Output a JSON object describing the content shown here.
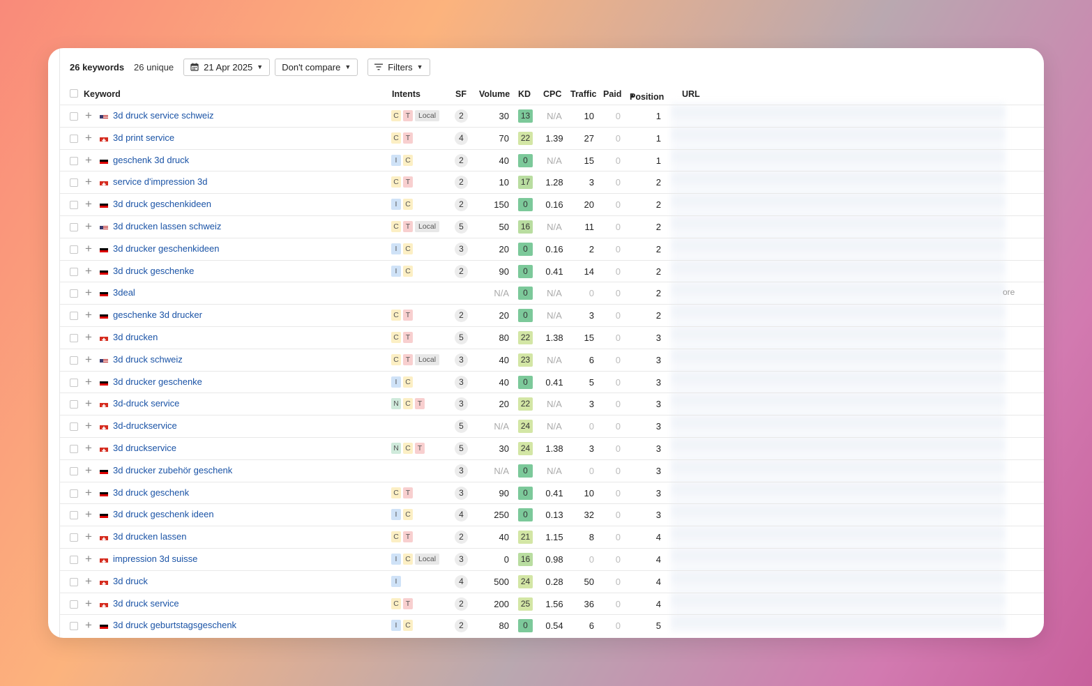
{
  "toolbar": {
    "keywords_count": "26 keywords",
    "unique_count": "26 unique",
    "date_label": "21 Apr 2025",
    "compare_label": "Don't compare",
    "filters_label": "Filters"
  },
  "columns": {
    "keyword": "Keyword",
    "intents": "Intents",
    "sf": "SF",
    "volume": "Volume",
    "kd": "KD",
    "cpc": "CPC",
    "traffic": "Traffic",
    "paid": "Paid",
    "position": "Position",
    "url": "URL"
  },
  "url_overflow_text": "ore",
  "colors": {
    "link": "#1a53a6",
    "kd_low": "#7cc99a",
    "kd_mid": "#b9dda0",
    "kd_high": "#d3e6a5"
  },
  "rows": [
    {
      "flag": "us",
      "keyword": "3d druck service schweiz",
      "intents": [
        "C",
        "T",
        "Local"
      ],
      "sf": "2",
      "volume": "30",
      "kd": "13",
      "cpc": "N/A",
      "traffic": "10",
      "paid": "0",
      "position": "1"
    },
    {
      "flag": "ch",
      "keyword": "3d print service",
      "intents": [
        "C",
        "T"
      ],
      "sf": "4",
      "volume": "70",
      "kd": "22",
      "cpc": "1.39",
      "traffic": "27",
      "paid": "0",
      "position": "1"
    },
    {
      "flag": "de",
      "keyword": "geschenk 3d druck",
      "intents": [
        "I",
        "C"
      ],
      "sf": "2",
      "volume": "40",
      "kd": "0",
      "cpc": "N/A",
      "traffic": "15",
      "paid": "0",
      "position": "1"
    },
    {
      "flag": "ch",
      "keyword": "service d'impression 3d",
      "intents": [
        "C",
        "T"
      ],
      "sf": "2",
      "volume": "10",
      "kd": "17",
      "cpc": "1.28",
      "traffic": "3",
      "paid": "0",
      "position": "2"
    },
    {
      "flag": "de",
      "keyword": "3d druck geschenkideen",
      "intents": [
        "I",
        "C"
      ],
      "sf": "2",
      "volume": "150",
      "kd": "0",
      "cpc": "0.16",
      "traffic": "20",
      "paid": "0",
      "position": "2"
    },
    {
      "flag": "us",
      "keyword": "3d drucken lassen schweiz",
      "intents": [
        "C",
        "T",
        "Local"
      ],
      "sf": "5",
      "volume": "50",
      "kd": "16",
      "cpc": "N/A",
      "traffic": "11",
      "paid": "0",
      "position": "2"
    },
    {
      "flag": "de",
      "keyword": "3d drucker geschenkideen",
      "intents": [
        "I",
        "C"
      ],
      "sf": "3",
      "volume": "20",
      "kd": "0",
      "cpc": "0.16",
      "traffic": "2",
      "paid": "0",
      "position": "2"
    },
    {
      "flag": "de",
      "keyword": "3d druck geschenke",
      "intents": [
        "I",
        "C"
      ],
      "sf": "2",
      "volume": "90",
      "kd": "0",
      "cpc": "0.41",
      "traffic": "14",
      "paid": "0",
      "position": "2"
    },
    {
      "flag": "de",
      "keyword": "3deal",
      "intents": [],
      "sf": "",
      "volume": "N/A",
      "kd": "0",
      "cpc": "N/A",
      "traffic": "0",
      "paid": "0",
      "position": "2"
    },
    {
      "flag": "de",
      "keyword": "geschenke 3d drucker",
      "intents": [
        "C",
        "T"
      ],
      "sf": "2",
      "volume": "20",
      "kd": "0",
      "cpc": "N/A",
      "traffic": "3",
      "paid": "0",
      "position": "2"
    },
    {
      "flag": "ch",
      "keyword": "3d drucken",
      "intents": [
        "C",
        "T"
      ],
      "sf": "5",
      "volume": "80",
      "kd": "22",
      "cpc": "1.38",
      "traffic": "15",
      "paid": "0",
      "position": "3"
    },
    {
      "flag": "us",
      "keyword": "3d druck schweiz",
      "intents": [
        "C",
        "T",
        "Local"
      ],
      "sf": "3",
      "volume": "40",
      "kd": "23",
      "cpc": "N/A",
      "traffic": "6",
      "paid": "0",
      "position": "3"
    },
    {
      "flag": "de",
      "keyword": "3d drucker geschenke",
      "intents": [
        "I",
        "C"
      ],
      "sf": "3",
      "volume": "40",
      "kd": "0",
      "cpc": "0.41",
      "traffic": "5",
      "paid": "0",
      "position": "3"
    },
    {
      "flag": "ch",
      "keyword": "3d-druck service",
      "intents": [
        "N",
        "C",
        "T"
      ],
      "sf": "3",
      "volume": "20",
      "kd": "22",
      "cpc": "N/A",
      "traffic": "3",
      "paid": "0",
      "position": "3"
    },
    {
      "flag": "ch",
      "keyword": "3d-druckservice",
      "intents": [],
      "sf": "5",
      "volume": "N/A",
      "kd": "24",
      "cpc": "N/A",
      "traffic": "0",
      "paid": "0",
      "position": "3"
    },
    {
      "flag": "ch",
      "keyword": "3d druckservice",
      "intents": [
        "N",
        "C",
        "T"
      ],
      "sf": "5",
      "volume": "30",
      "kd": "24",
      "cpc": "1.38",
      "traffic": "3",
      "paid": "0",
      "position": "3"
    },
    {
      "flag": "de",
      "keyword": "3d drucker zubehör geschenk",
      "intents": [],
      "sf": "3",
      "volume": "N/A",
      "kd": "0",
      "cpc": "N/A",
      "traffic": "0",
      "paid": "0",
      "position": "3"
    },
    {
      "flag": "de",
      "keyword": "3d druck geschenk",
      "intents": [
        "C",
        "T"
      ],
      "sf": "3",
      "volume": "90",
      "kd": "0",
      "cpc": "0.41",
      "traffic": "10",
      "paid": "0",
      "position": "3"
    },
    {
      "flag": "de",
      "keyword": "3d druck geschenk ideen",
      "intents": [
        "I",
        "C"
      ],
      "sf": "4",
      "volume": "250",
      "kd": "0",
      "cpc": "0.13",
      "traffic": "32",
      "paid": "0",
      "position": "3"
    },
    {
      "flag": "ch",
      "keyword": "3d drucken lassen",
      "intents": [
        "C",
        "T"
      ],
      "sf": "2",
      "volume": "40",
      "kd": "21",
      "cpc": "1.15",
      "traffic": "8",
      "paid": "0",
      "position": "4"
    },
    {
      "flag": "ch",
      "keyword": "impression 3d suisse",
      "intents": [
        "I",
        "C",
        "Local"
      ],
      "sf": "3",
      "volume": "0",
      "kd": "16",
      "cpc": "0.98",
      "traffic": "0",
      "paid": "0",
      "position": "4"
    },
    {
      "flag": "ch",
      "keyword": "3d druck",
      "intents": [
        "I"
      ],
      "sf": "4",
      "volume": "500",
      "kd": "24",
      "cpc": "0.28",
      "traffic": "50",
      "paid": "0",
      "position": "4"
    },
    {
      "flag": "ch",
      "keyword": "3d druck service",
      "intents": [
        "C",
        "T"
      ],
      "sf": "2",
      "volume": "200",
      "kd": "25",
      "cpc": "1.56",
      "traffic": "36",
      "paid": "0",
      "position": "4"
    },
    {
      "flag": "de",
      "keyword": "3d druck geburtstagsgeschenk",
      "intents": [
        "I",
        "C"
      ],
      "sf": "2",
      "volume": "80",
      "kd": "0",
      "cpc": "0.54",
      "traffic": "6",
      "paid": "0",
      "position": "5"
    }
  ]
}
